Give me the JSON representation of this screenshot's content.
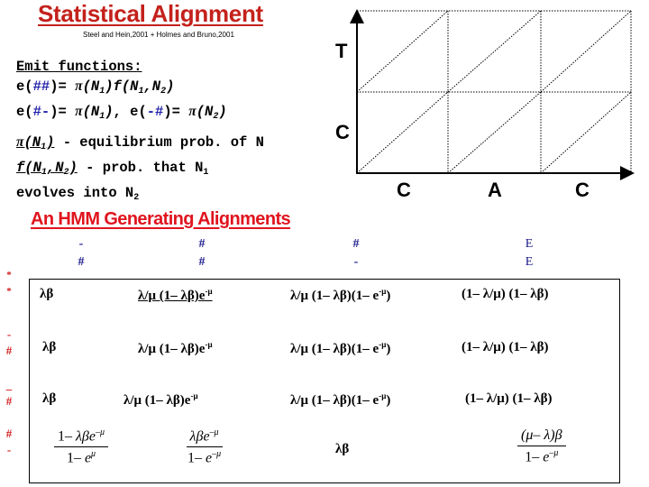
{
  "slide": {
    "title": "Statistical Alignment",
    "subtitle": "Steel and Hein,2001 + Holmes and Bruno,2001"
  },
  "emit": {
    "heading": "Emit functions:",
    "line1": {
      "lhs_pre": "e(",
      "lhs_sym": "##",
      "lhs_post": ")= ",
      "rhs": "π(N1)f(N1,N2)"
    },
    "line2": {
      "a_pre": "e(",
      "a_sym": "#-",
      "a_post": ")= ",
      "a_rhs": "π(N1)",
      "sep": ", ",
      "b_pre": "e(",
      "b_sym": "-#",
      "b_post": ")= ",
      "b_rhs": "π(N2)"
    }
  },
  "definitions": {
    "pi_term": "π(N1)",
    "pi_desc": " - equilibrium prob. of N",
    "f_term": "f(N1,N2)",
    "f_desc": " - prob. that N1",
    "f_desc2": "evolves into N2"
  },
  "grid_diagram": {
    "y_labels": [
      "T",
      "C"
    ],
    "x_labels": [
      "C",
      "A",
      "C"
    ]
  },
  "hmm": {
    "title": "An HMM Generating Alignments",
    "columns": [
      {
        "top": "-",
        "bottom": "#"
      },
      {
        "top": "#",
        "bottom": "#"
      },
      {
        "top": "#",
        "bottom": "-"
      },
      {
        "top": "E",
        "bottom": "E"
      }
    ],
    "rows": [
      {
        "label_top": "*",
        "label_bottom": "*",
        "cells": [
          "λβ",
          "λ/μ (1– λβ)e-μ",
          "λ/μ (1– λβ)(1– e-μ)",
          "(1– λ/μ) (1– λβ)"
        ]
      },
      {
        "label_top": "-",
        "label_bottom": "#",
        "cells": [
          "λβ",
          "λ/μ (1– λβ)e-μ",
          "λ/μ (1– λβ)(1– e-μ)",
          "(1– λ/μ) (1– λβ)"
        ]
      },
      {
        "label_top": "_",
        "label_bottom": "#",
        "cells": [
          "λβ",
          "λ/μ (1– λβ)e-μ",
          "λ/μ (1– λβ)(1– e-μ)",
          "(1– λ/μ) (1– λβ)"
        ]
      },
      {
        "label_top": "#",
        "label_bottom": "-",
        "cells": [
          {
            "num": "1– λβe",
            "num_sup": "–μ",
            "den": "1– e",
            "den_sup": "μ"
          },
          {
            "num": "λβe",
            "num_sup": "–μ",
            "den": "1– e",
            "den_sup": "–μ"
          },
          "λβ",
          {
            "num": "(μ– λ)β",
            "num_sup": "",
            "den": "1– e",
            "den_sup": "–μ"
          }
        ]
      }
    ]
  }
}
